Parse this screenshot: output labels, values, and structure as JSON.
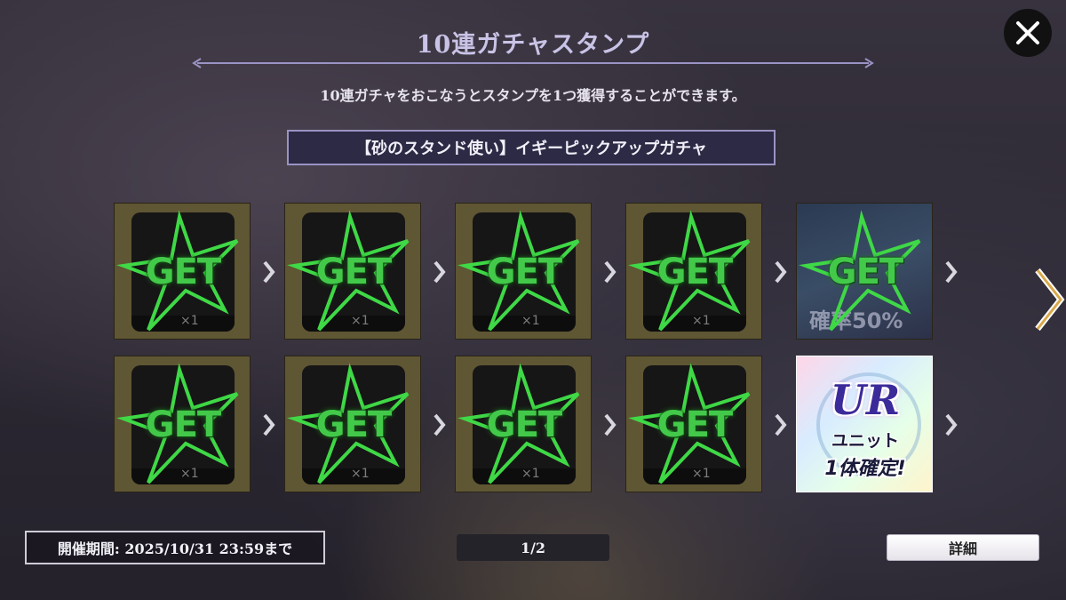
{
  "header": {
    "title": "10連ガチャスタンプ",
    "subtitle": "10連ガチャをおこなうとスタンプを1つ獲得することができます。"
  },
  "gacha_name": "【砂のスタンド使い】イギーピックアップガチャ",
  "stamps": {
    "get_label": "GET",
    "qty_label": "×1",
    "slot5_text": "確率50%",
    "slot10_logo": "UR",
    "slot10_line1": "ユニット",
    "slot10_line2": "1体確定!"
  },
  "footer": {
    "period": "開催期間: 2025/10/31 23:59まで",
    "page": "1/2",
    "detail_button": "詳細"
  },
  "colors": {
    "get_green": "#43c94a",
    "accent_purple": "#9a93c4",
    "next_arrow_gold": "#d9a84a"
  },
  "icons": [
    "close-icon",
    "chevron-right-icon",
    "page-next-icon",
    "get-star-icon"
  ]
}
